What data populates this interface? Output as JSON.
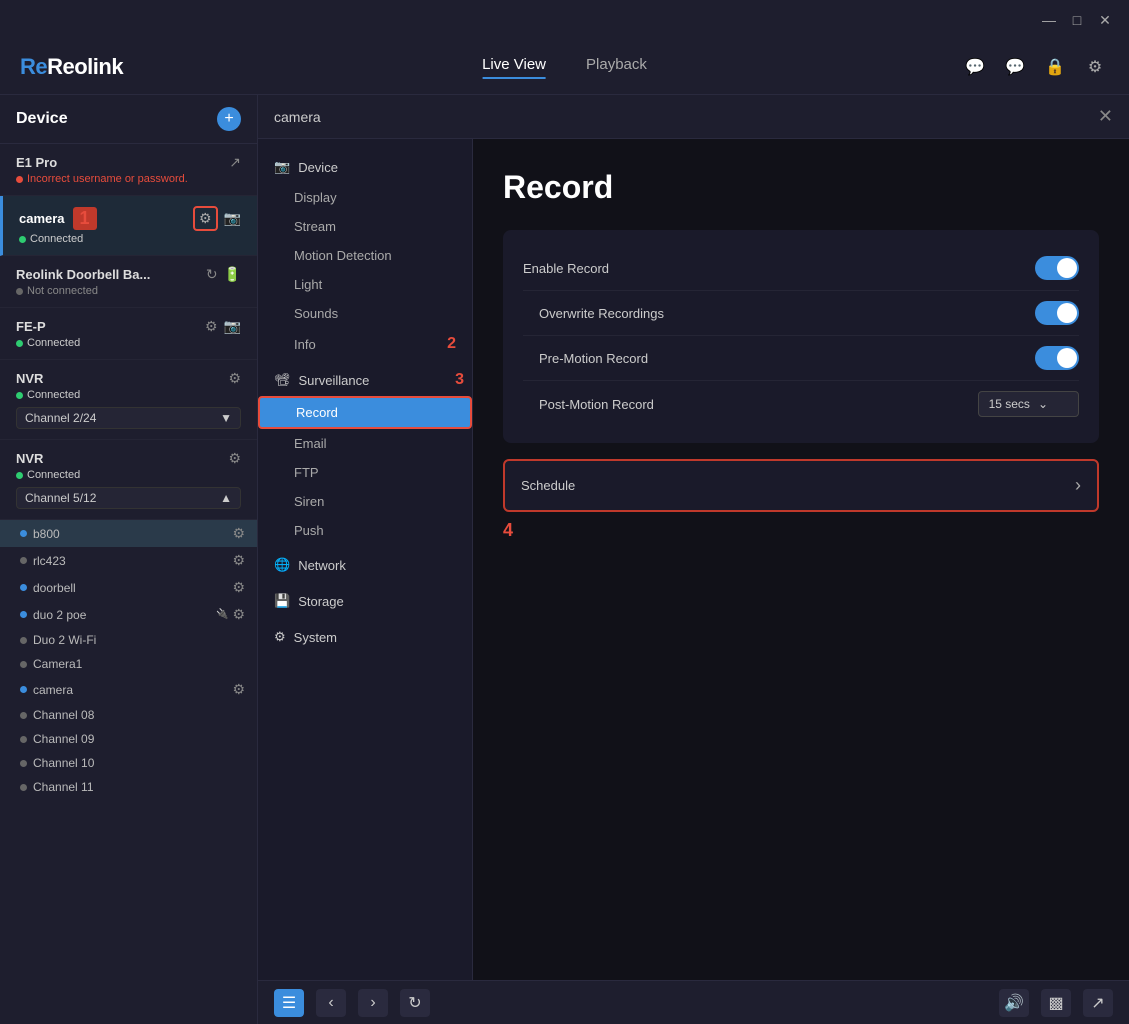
{
  "titlebar": {
    "minimize": "—",
    "maximize": "□",
    "close": "✕"
  },
  "topnav": {
    "logo": "Reolink",
    "tabs": [
      {
        "id": "live",
        "label": "Live View",
        "active": true
      },
      {
        "id": "playback",
        "label": "Playback",
        "active": false
      }
    ],
    "icons": [
      "chat-bubble",
      "message",
      "lock",
      "settings"
    ]
  },
  "sidebar": {
    "title": "Device",
    "devices": [
      {
        "name": "E1 Pro",
        "status": "error",
        "statusText": "Incorrect username or password.",
        "icons": [
          "external-link"
        ]
      },
      {
        "name": "camera",
        "status": "connected",
        "statusText": "Connected",
        "icons": [
          "settings",
          "camera"
        ],
        "badge": "1",
        "highlight": true
      },
      {
        "name": "Reolink Doorbell Ba...",
        "status": "not-connected",
        "statusText": "Not connected",
        "icons": [
          "refresh",
          "battery"
        ]
      },
      {
        "name": "FE-P",
        "status": "connected",
        "statusText": "Connected",
        "icons": [
          "settings",
          "camera"
        ]
      },
      {
        "name": "NVR",
        "status": "connected",
        "statusText": "Connected",
        "icons": [
          "settings"
        ],
        "channel": "Channel 2/24",
        "channelExpanded": false
      },
      {
        "name": "NVR",
        "status": "connected",
        "statusText": "Connected",
        "icons": [
          "settings"
        ],
        "channel": "Channel 5/12",
        "channelExpanded": true,
        "subChannels": [
          {
            "name": "b800",
            "active": true,
            "dot": "blue"
          },
          {
            "name": "rlc423",
            "dot": "none"
          },
          {
            "name": "doorbell",
            "dot": "blue"
          },
          {
            "name": "duo 2 poe",
            "dot": "blue"
          },
          {
            "name": "Duo 2 Wi-Fi",
            "dot": "gray"
          },
          {
            "name": "Camera1",
            "dot": "gray"
          },
          {
            "name": "camera",
            "dot": "blue"
          },
          {
            "name": "Channel 08",
            "dot": "gray"
          },
          {
            "name": "Channel 09",
            "dot": "gray"
          },
          {
            "name": "Channel 10",
            "dot": "gray"
          },
          {
            "name": "Channel 11",
            "dot": "gray"
          }
        ]
      }
    ]
  },
  "panel": {
    "title": "camera",
    "close": "✕"
  },
  "leftmenu": {
    "sections": [
      {
        "id": "device",
        "label": "Device",
        "icon": "camera",
        "items": [
          "Display",
          "Stream",
          "Motion Detection",
          "Light",
          "Sounds",
          "Info"
        ]
      },
      {
        "id": "surveillance",
        "label": "Surveillance",
        "icon": "monitor",
        "items": [
          "Record",
          "Email",
          "FTP",
          "Siren",
          "Push"
        ],
        "expanded": true
      },
      {
        "id": "network",
        "label": "Network",
        "icon": "globe"
      },
      {
        "id": "storage",
        "label": "Storage",
        "icon": "hdd"
      },
      {
        "id": "system",
        "label": "System",
        "icon": "gear"
      }
    ],
    "activeItem": "Record",
    "annotation2": "2",
    "annotation3": "3"
  },
  "record": {
    "title": "Record",
    "settings": [
      {
        "id": "enable-record",
        "label": "Enable Record",
        "type": "toggle",
        "value": true
      },
      {
        "id": "overwrite",
        "label": "Overwrite Recordings",
        "type": "toggle",
        "value": true
      },
      {
        "id": "pre-motion",
        "label": "Pre-Motion Record",
        "type": "toggle",
        "value": true
      },
      {
        "id": "post-motion",
        "label": "Post-Motion Record",
        "type": "dropdown",
        "value": "15 secs"
      }
    ],
    "schedule": {
      "label": "Schedule",
      "chevron": "›"
    },
    "annotation4": "4"
  },
  "bottombar": {
    "left_buttons": [
      "menu",
      "back",
      "forward",
      "refresh"
    ],
    "right_buttons": [
      "volume",
      "display",
      "fullscreen"
    ]
  }
}
